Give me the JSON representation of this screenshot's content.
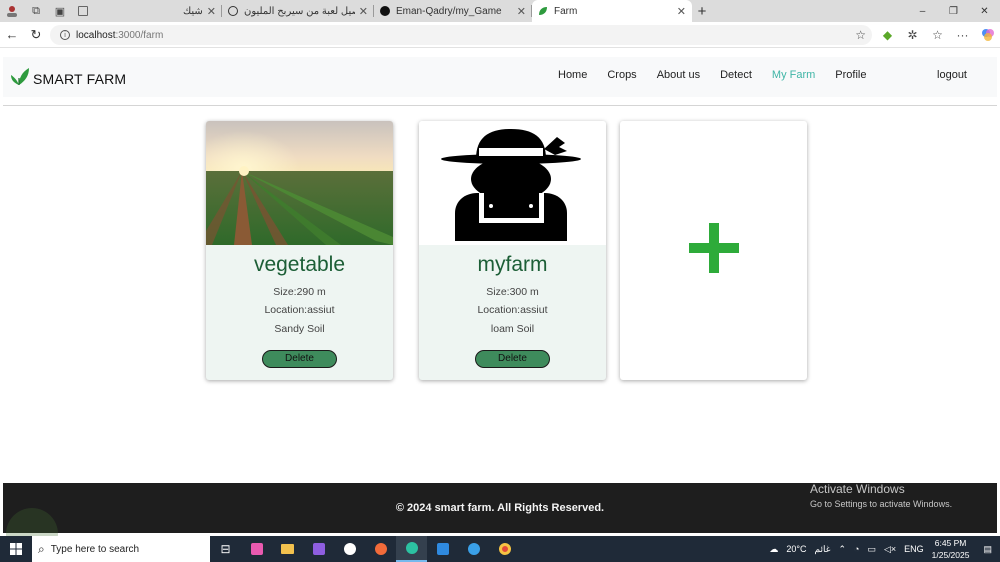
{
  "browser": {
    "tabs": [
      {
        "title": "شيك",
        "icon": "page-icon"
      },
      {
        "title": "تفاصيل لعبة من سيربح المليون",
        "icon": "openai-icon"
      },
      {
        "title": "Eman-Qadry/my_Game",
        "icon": "github-icon"
      },
      {
        "title": "Farm",
        "icon": "leaf-icon"
      }
    ],
    "url_host": "localhost",
    "url_path": ":3000/farm",
    "window_controls": {
      "minimize": "–",
      "maximize": "❐",
      "close": "✕"
    }
  },
  "navbar": {
    "brand": "SMART FARM",
    "items": [
      "Home",
      "Crops",
      "About us",
      "Detect",
      "My Farm",
      "Profile"
    ],
    "active_item": "My Farm",
    "logout": "logout",
    "active_color": "#3fb5a6"
  },
  "farms": [
    {
      "name": "vegetable",
      "size": "Size:290 m",
      "location": "Location:assiut",
      "soil": "Sandy Soil",
      "delete_label": "Delete",
      "image": "field-sunset-photo"
    },
    {
      "name": "myfarm",
      "size": "Size:300 m",
      "location": "Location:assiut",
      "soil": "loam Soil",
      "delete_label": "Delete",
      "image": "farmer-silhouette"
    }
  ],
  "add_card": {
    "icon": "plus-icon",
    "color": "#2eab3a"
  },
  "footer": {
    "text": "© 2024 smart farm. All Rights Reserved."
  },
  "activate_windows": {
    "title": "Activate Windows",
    "subtitle": "Go to Settings to activate Windows."
  },
  "taskbar": {
    "search_placeholder": "Type here to search",
    "weather": "20°C",
    "weather_text": "غائم",
    "language": "ENG",
    "time": "6:45 PM",
    "date": "1/25/2025"
  },
  "colors": {
    "primary_green": "#1c5e36",
    "button_green": "#3e8b5c",
    "card_bg": "#eef5f2",
    "footer_bg": "#1e1e1e"
  }
}
